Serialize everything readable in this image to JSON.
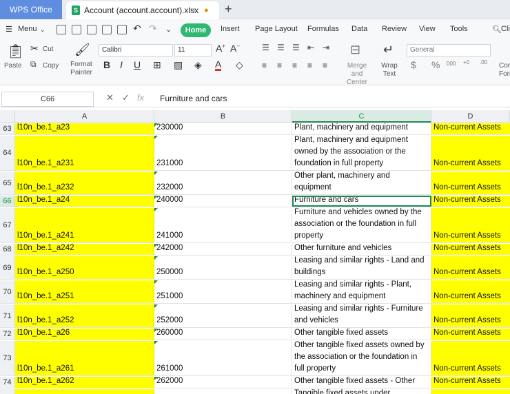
{
  "app": {
    "wps_tab": "WPS Office",
    "doc_tab": "Account (account.account).xlsx",
    "new_tab": "+"
  },
  "menu": {
    "menu_label": "Menu",
    "home": "Home",
    "items": [
      "Insert",
      "Page Layout",
      "Formulas",
      "Data",
      "Review",
      "View",
      "Tools"
    ],
    "search_partial": "Cli"
  },
  "ribbon": {
    "paste": "Paste",
    "cut": "Cut",
    "copy": "Copy",
    "format_painter": "Format Painter",
    "font": "Calibri",
    "size": "11",
    "merge_center": "Merge and Center",
    "wrap_text": "Wrap Text",
    "number_format": "General",
    "cond_format_partial": "Cor Forn"
  },
  "formula_bar": {
    "name_box": "C66",
    "content": "Furniture and cars"
  },
  "columns": [
    "A",
    "B",
    "C",
    "D"
  ],
  "selected_column": "C",
  "selected_row": "66",
  "rows": [
    {
      "n": "63",
      "a": "l10n_be.1_a23",
      "b": "230000",
      "c": "Plant, machinery and equipment",
      "d": "Non-current Assets"
    },
    {
      "n": "64",
      "a": "l10n_be.1_a231",
      "b": "231000",
      "c": "Plant, machinery and equipment owned by the association or the foundation in full property",
      "d": "Non-current Assets"
    },
    {
      "n": "65",
      "a": "l10n_be.1_a232",
      "b": "232000",
      "c": "Other plant, machinery and equipment",
      "d": "Non-current Assets"
    },
    {
      "n": "66",
      "a": "l10n_be.1_a24",
      "b": "240000",
      "c": "Furniture and cars",
      "d": "Non-current Assets"
    },
    {
      "n": "67",
      "a": "l10n_be.1_a241",
      "b": "241000",
      "c": "Furniture and vehicles owned by the association or the foundation in full property",
      "d": "Non-current Assets"
    },
    {
      "n": "68",
      "a": "l10n_be.1_a242",
      "b": "242000",
      "c": "Other furniture and vehicles",
      "d": "Non-current Assets"
    },
    {
      "n": "69",
      "a": "l10n_be.1_a250",
      "b": "250000",
      "c": "Leasing and similar rights - Land and buildings",
      "d": "Non-current Assets"
    },
    {
      "n": "70",
      "a": "l10n_be.1_a251",
      "b": "251000",
      "c": "Leasing and similar rights - Plant, machinery and equipment",
      "d": "Non-current Assets"
    },
    {
      "n": "71",
      "a": "l10n_be.1_a252",
      "b": "252000",
      "c": "Leasing and similar rights - Furniture and vehicles",
      "d": "Non-current Assets"
    },
    {
      "n": "72",
      "a": "l10n_be.1_a26",
      "b": "260000",
      "c": "Other tangible fixed assets",
      "d": "Non-current Assets"
    },
    {
      "n": "73",
      "a": "l10n_be.1_a261",
      "b": "261000",
      "c": "Other tangible fixed assets owned by the association or the foundation in full property",
      "d": "Non-current Assets"
    },
    {
      "n": "74",
      "a": "l10n_be.1_a262",
      "b": "262000",
      "c": "Other tangible fixed assets - Other",
      "d": "Non-current Assets"
    },
    {
      "n": "",
      "a": "",
      "b": "",
      "c": "Tangible fixed assets under",
      "d": ""
    }
  ]
}
